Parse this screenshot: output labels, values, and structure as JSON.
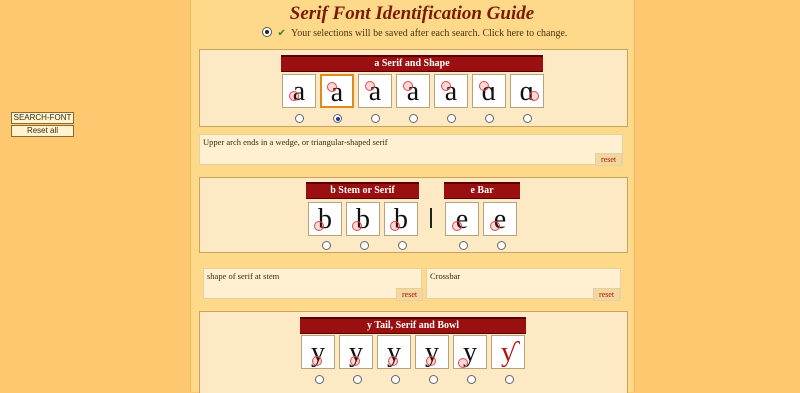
{
  "page": {
    "title": "Serif Font Identification Guide",
    "notice": "Your selections will be saved after each search. Click here to change."
  },
  "sidebar": {
    "search_label": "SEARCH-FONT",
    "reset_all_label": "Reset all"
  },
  "sections": {
    "a": {
      "heading": "a Serif and Shape",
      "glyphs": [
        "a",
        "a",
        "a",
        "a",
        "a",
        "ɑ",
        "ɑ"
      ],
      "selected_index": 1,
      "description": "Upper arch ends in a wedge, or triangular-shaped serif",
      "reset_label": "reset"
    },
    "b": {
      "heading": "b Stem or Serif",
      "glyphs": [
        "b",
        "b",
        "b"
      ],
      "description": "shape of serif at stem",
      "reset_label": "reset"
    },
    "e": {
      "heading": "e Bar",
      "glyphs": [
        "e",
        "e"
      ],
      "description": "Crossbar",
      "reset_label": "reset"
    },
    "y": {
      "heading": "y Tail, Serif and Bowl",
      "glyphs": [
        "y",
        "y",
        "y",
        "y",
        "y",
        "ƴ"
      ]
    }
  },
  "colors": {
    "background": "#fec870",
    "main_column": "#ffd98a",
    "header_red": "#9a0f0f",
    "title_brown": "#7a1a00",
    "selected_border": "#e08a1e",
    "marker_red": "#e04848"
  }
}
